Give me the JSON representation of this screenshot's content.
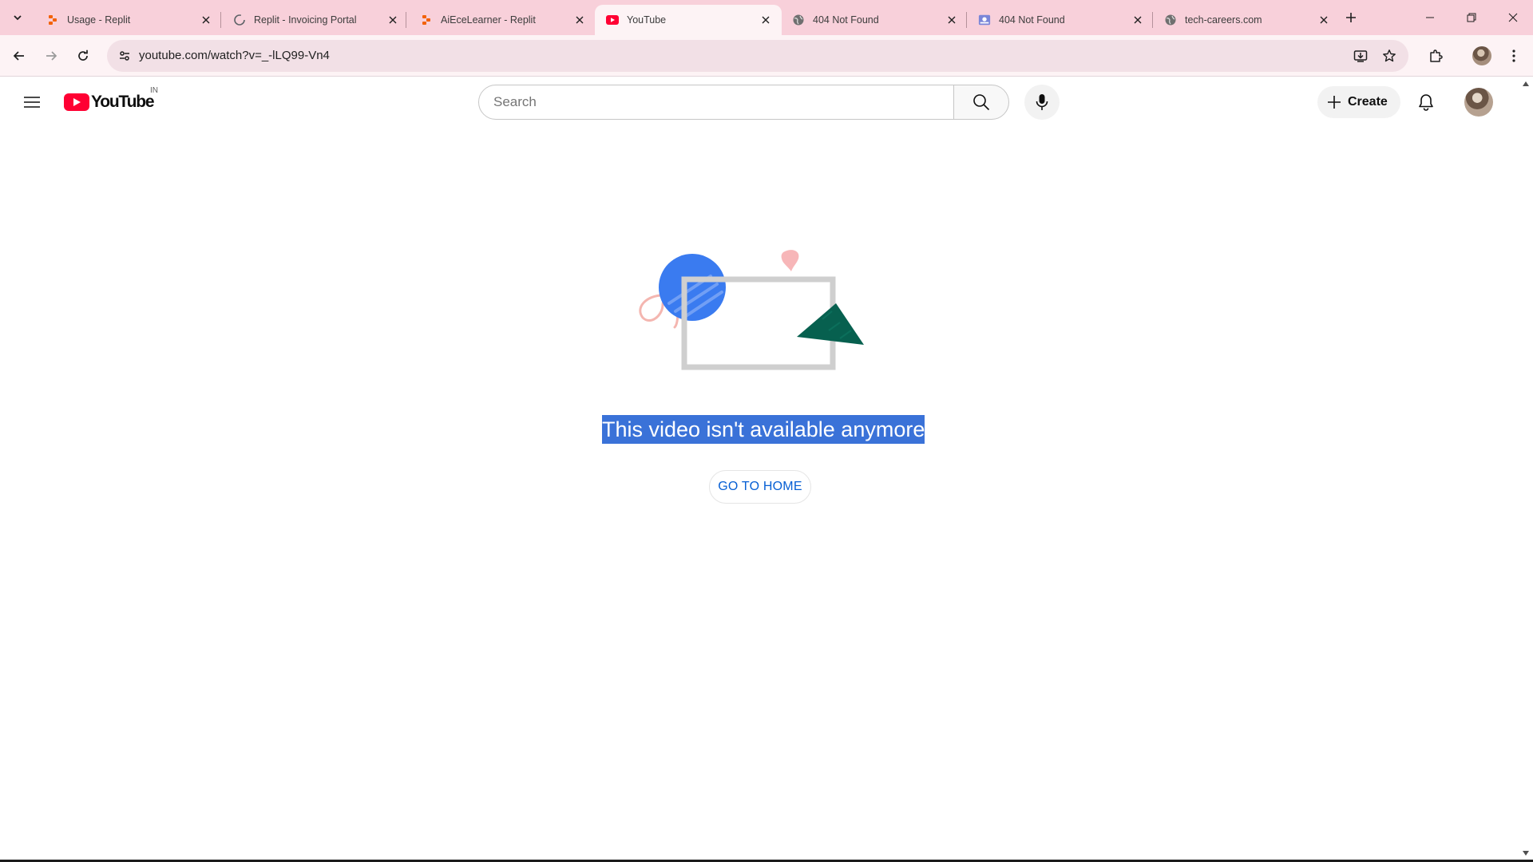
{
  "browser": {
    "tabs": [
      {
        "title": "Usage - Replit",
        "favicon": "replit-icon",
        "active": false
      },
      {
        "title": "Replit - Invoicing Portal",
        "favicon": "loading-spinner-icon",
        "active": false
      },
      {
        "title": "AiEceLearner - Replit",
        "favicon": "replit-icon",
        "active": false
      },
      {
        "title": "YouTube",
        "favicon": "youtube-icon",
        "active": true
      },
      {
        "title": "404 Not Found",
        "favicon": "globe-icon",
        "active": false
      },
      {
        "title": "404 Not Found",
        "favicon": "page-icon",
        "active": false
      },
      {
        "title": "tech-careers.com",
        "favicon": "globe-icon",
        "active": false
      }
    ],
    "address": {
      "url": "youtube.com/watch?v=_-lLQ99-Vn4"
    }
  },
  "youtube": {
    "logo_text": "YouTube",
    "country_code": "IN",
    "search": {
      "placeholder": "Search"
    },
    "create_label": "Create"
  },
  "error": {
    "message": "This video isn't available anymore",
    "home_button": "GO TO HOME"
  },
  "colors": {
    "tabstrip": "#f8d0da",
    "toolbar": "#fdf3f5",
    "youtube_red": "#ff0033",
    "selection": "#3a72d8",
    "link_blue": "#065fd4"
  }
}
